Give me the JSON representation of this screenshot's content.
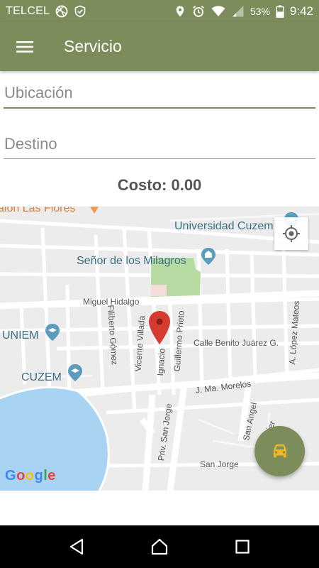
{
  "status_bar": {
    "carrier": "TELCEL",
    "battery": "53%",
    "time": "9:42"
  },
  "app_bar": {
    "title": "Servicio"
  },
  "form": {
    "origin_placeholder": "Ubicación",
    "origin_value": "",
    "destination_placeholder": "Destino",
    "destination_value": "",
    "cost_text": "Costo: 0.00"
  },
  "map": {
    "places": {
      "salon": "alón Las Flores",
      "universidad": "Universidad Cuzem",
      "senor": "Señor de los Milagros",
      "uniem": "UNIEM",
      "cuzem": "CUZEM"
    },
    "streets": {
      "miguel_hidalgo": "Miguel Hidalgo",
      "filiberto": "Filiberto Gómez",
      "vicente": "Vicente Villada",
      "ignacio": "Ignacio",
      "guillermo": "Guillermo Prieto",
      "benito": "Calle Benito Juárez G.",
      "lopez_mateos": "A. López Mateos",
      "morelos": "J. Ma. Morelos",
      "priv_san_jorge": "Priv. San Jorge",
      "san_angel": "San Angel",
      "javier": "Javier",
      "san_jorge": "San Jorge"
    },
    "attribution": "Google"
  },
  "colors": {
    "primary": "#7c8d5b",
    "pin": "#d63b2f",
    "water": "#a9d3f3",
    "park": "#b7dba0",
    "car_icon": "#f2b824"
  }
}
